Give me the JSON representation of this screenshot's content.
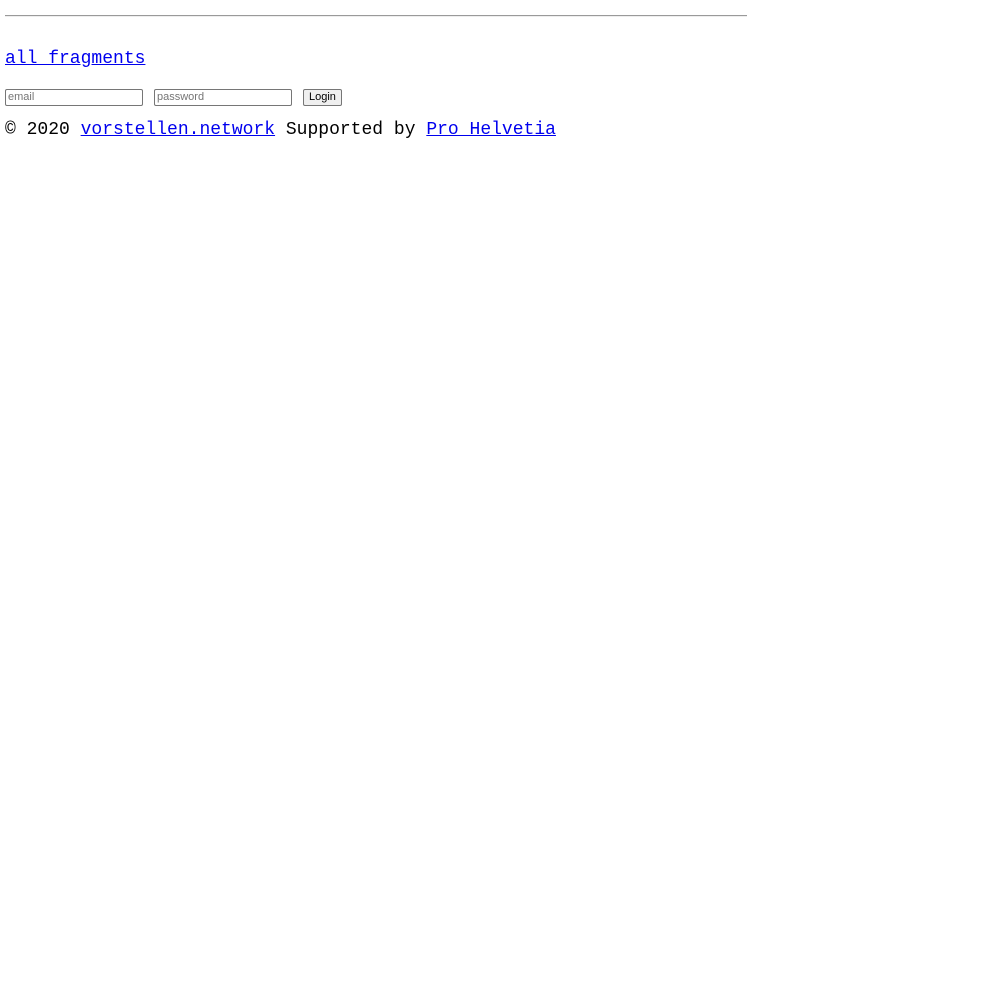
{
  "nav": {
    "all_fragments_label": "all fragments"
  },
  "login": {
    "email_placeholder": "email",
    "email_value": "",
    "password_placeholder": "password",
    "password_value": "",
    "button_label": "Login"
  },
  "footer": {
    "copyright": "© 2020",
    "site_link_label": "vorstellen.network",
    "supported_by": "Supported by",
    "sponsor_link_label": "Pro Helvetia"
  },
  "colors": {
    "link": "#0000ee",
    "text": "#000000",
    "background": "#ffffff",
    "rule": "#9a9a9a"
  }
}
